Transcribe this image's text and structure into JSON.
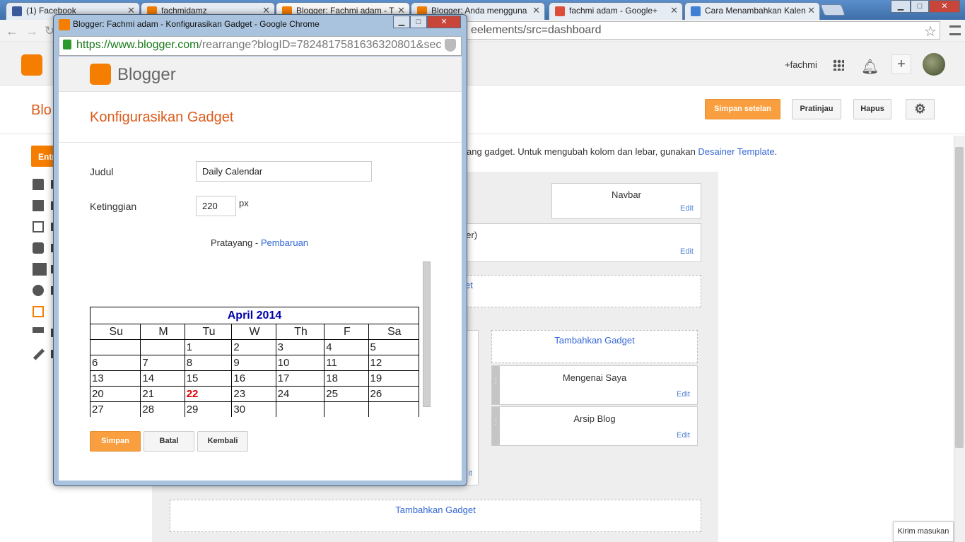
{
  "browser": {
    "tabs": [
      {
        "label": "(1) Facebook",
        "color": "#3b5998"
      },
      {
        "label": "fachmidamz",
        "color": "#f57d00"
      },
      {
        "label": "Blogger: Fachmi adam - T",
        "color": "#f57d00"
      },
      {
        "label": "Blogger: Anda mengguna",
        "color": "#f57d00"
      },
      {
        "label": "fachmi adam - Google+",
        "color": "#dd4b39"
      },
      {
        "label": "Cara Menambahkan Kalen",
        "color": "#3f7fd6"
      }
    ],
    "address_visible": "eelements/src=dashboard"
  },
  "header": {
    "user_name": "+fachmi"
  },
  "page": {
    "blog_title": "Blo",
    "save_label": "Simpan setelan",
    "preview_label": "Pratinjau",
    "delete_label": "Hapus",
    "entry_label": "Entri",
    "description": "ang gadget. Untuk mengubah kolom dan lebar, gunakan ",
    "designer_link": "Desainer Template",
    "description_end": ".",
    "feedback_label": "Kirim masukan"
  },
  "layout": {
    "navbar_label": "Navbar",
    "header_label": "der)",
    "header_link_fragment": "et",
    "add_gadget": "Tambahkan Gadget",
    "add_gadget_bottom": "Tambahkan Gadget",
    "about_label": "Mengenai Saya",
    "archive_label": "Arsip Blog",
    "edit_label": "Edit",
    "it_fragment": "it"
  },
  "popup": {
    "window_title": "Blogger: Fachmi adam - Konfigurasikan Gadget - Google Chrome",
    "url_main": "https://www.blogger.com",
    "url_path": "/rearrange?blogID=7824817581636320801&sec",
    "logo_text": "Blogger",
    "heading": "Konfigurasikan Gadget",
    "title_label": "Judul",
    "title_value": "Daily Calendar",
    "height_label": "Ketinggian",
    "height_value": "220",
    "height_unit": "px",
    "preview_label": "Pratayang - ",
    "refresh_link": "Pembaruan",
    "save_label": "Simpan",
    "cancel_label": "Batal",
    "back_label": "Kembali"
  },
  "calendar": {
    "month_title": "April 2014",
    "day_names": [
      "Su",
      "M",
      "Tu",
      "W",
      "Th",
      "F",
      "Sa"
    ],
    "weeks": [
      [
        "",
        "",
        "1",
        "2",
        "3",
        "4",
        "5"
      ],
      [
        "6",
        "7",
        "8",
        "9",
        "10",
        "11",
        "12"
      ],
      [
        "13",
        "14",
        "15",
        "16",
        "17",
        "18",
        "19"
      ],
      [
        "20",
        "21",
        "22",
        "23",
        "24",
        "25",
        "26"
      ],
      [
        "27",
        "28",
        "29",
        "30",
        "",
        "",
        ""
      ]
    ],
    "today": "22",
    "today_color": "#e00000"
  }
}
